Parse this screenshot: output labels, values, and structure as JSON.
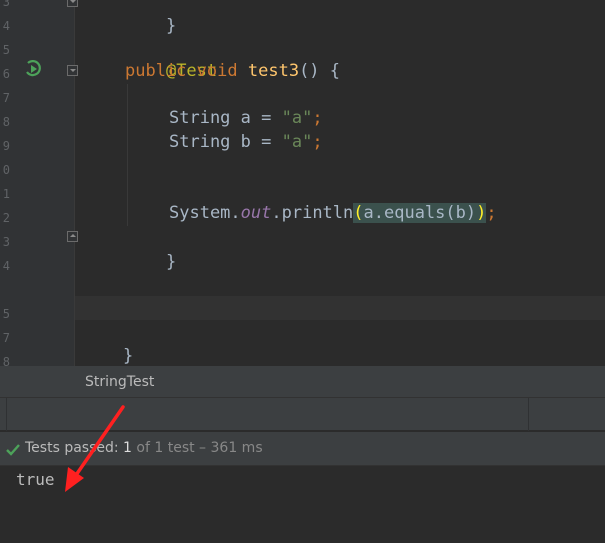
{
  "editor": {
    "gutter_lines": [
      "3",
      "4",
      "5",
      "6",
      "7",
      "8",
      "9",
      "0",
      "1",
      "2",
      "3",
      "4",
      "5",
      "7",
      "8"
    ],
    "code": {
      "closing_brace_top": "}",
      "annotation": "@Test",
      "kw_public": "public",
      "kw_void": "void",
      "method_name": "test3",
      "method_sig_rest": "() {",
      "decl_type": "String",
      "var_a": " a = ",
      "var_b": " b = ",
      "str_a": "\"a\"",
      "semicolon": ";",
      "system": "System.",
      "out": "out",
      "println": ".println",
      "open_paren": "(",
      "a_equals": "a.equals",
      "paren_b_open": "(",
      "b": "b",
      "paren_b_close": ")",
      "close_paren": ")",
      "method_close": "}",
      "class_close": "}"
    }
  },
  "test_panel": {
    "title": "StringTest",
    "status_prefix": "Tests passed: ",
    "passed_count": "1",
    "status_suffix": " of 1 test – 361 ms",
    "console_output": "true"
  },
  "colors": {
    "background": "#2b2b2b",
    "keyword": "#cc7832",
    "annotation": "#bbb529",
    "string": "#6a8759",
    "method": "#ffc66d",
    "pass": "#4da25a",
    "arrow": "#ff2020"
  }
}
